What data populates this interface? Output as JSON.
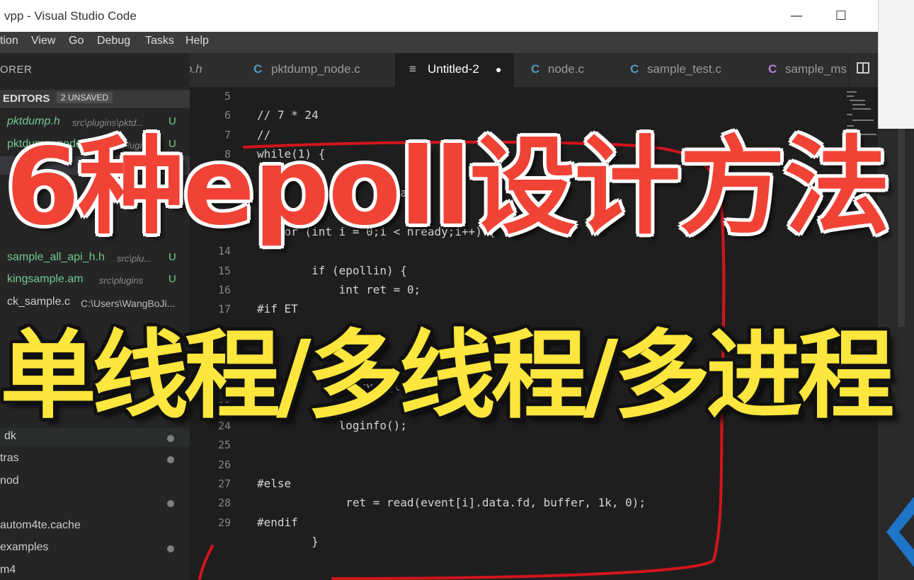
{
  "window": {
    "title": "vpp - Visual Studio Code",
    "minimize": "—",
    "maximize": "☐"
  },
  "menu": [
    "tion",
    "View",
    "Go",
    "Debug",
    "Tasks",
    "Help"
  ],
  "sidebar": {
    "header": "ORER",
    "open_editors": {
      "label": "EDITORS",
      "badge": "2 UNSAVED"
    },
    "files": [
      {
        "name": "pktdump.h",
        "path": "src\\plugins\\pktd...",
        "status": "U"
      },
      {
        "name": "pktdump_node.c",
        "path": "src\\plugi...",
        "status": "U"
      },
      {
        "name": "sample_all_api_h.h",
        "path": "src\\plu...",
        "status": "U"
      },
      {
        "name": "kingsample.am",
        "path": "src\\plugins",
        "status": "U"
      },
      {
        "name": "ck_sample.c",
        "path": "C:\\Users\\WangBoJi...",
        "status": ""
      }
    ],
    "tree": [
      "dk",
      "tras",
      "nod",
      "autom4te.cache",
      "examples",
      "m4"
    ]
  },
  "tabs": [
    {
      "label": "p.h",
      "icon": ""
    },
    {
      "label": "pktdump_node.c",
      "icon": "C"
    },
    {
      "label": "Untitled-2",
      "icon": "≡",
      "dirty": "●"
    },
    {
      "label": "node.c",
      "icon": "C"
    },
    {
      "label": "sample_test.c",
      "icon": "C"
    },
    {
      "label": "sample_ms",
      "icon": "C"
    }
  ],
  "editor": {
    "lines": [
      {
        "n": "5",
        "code": ""
      },
      {
        "n": "6",
        "code": "// 7 * 24"
      },
      {
        "n": "7",
        "code": "//"
      },
      {
        "n": "8",
        "code": "while(1) {"
      },
      {
        "n": "9",
        "code": ""
      },
      {
        "n": "",
        "code": "        n            a     ;"
      },
      {
        "n": "",
        "code": ""
      },
      {
        "n": "",
        "code": "    or (int i = 0;i < nready;i++) {"
      },
      {
        "n": "14",
        "code": ""
      },
      {
        "n": "15",
        "code": "        if (epollin) {"
      },
      {
        "n": "16",
        "code": "            int ret = 0;"
      },
      {
        "n": "17",
        "code": "#if ET"
      },
      {
        "n": "",
        "code": ""
      },
      {
        "n": "",
        "code": ""
      },
      {
        "n": "",
        "code": ""
      },
      {
        "n": "22",
        "code": "            query_sql(); //"
      },
      {
        "n": "23",
        "code": ""
      },
      {
        "n": "24",
        "code": "            loginfo();"
      },
      {
        "n": "25",
        "code": ""
      },
      {
        "n": "26",
        "code": ""
      },
      {
        "n": "27",
        "code": "#else"
      },
      {
        "n": "28",
        "code": "             ret = read(event[i].data.fd, buffer, 1k, 0);"
      },
      {
        "n": "29",
        "code": "#endif"
      },
      {
        "n": "",
        "code": "        }"
      }
    ]
  },
  "overlay": {
    "title": "6种epoll设计方法",
    "subtitle": "单线程/多线程/多进程"
  },
  "colors": {
    "title_red": "#f04336",
    "subtitle_yellow": "#fde63d",
    "pen_red": "#d4141c"
  }
}
